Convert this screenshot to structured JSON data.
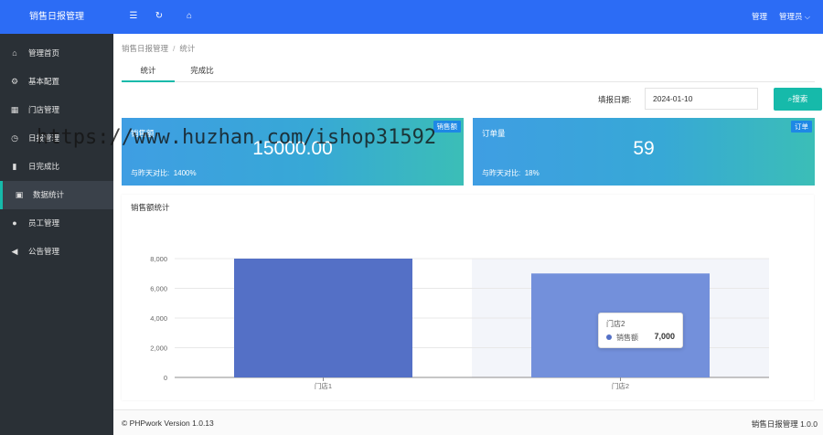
{
  "app": {
    "title": "销售日报管理"
  },
  "topbar": {
    "icons": [
      "menu-icon",
      "refresh-icon",
      "home-icon"
    ],
    "admin_link": "管理",
    "user_menu": "管理员",
    "user_caret": "⌵"
  },
  "sidebar": {
    "items": [
      {
        "label": "管理首页",
        "icon": "home-icon"
      },
      {
        "label": "基本配置",
        "icon": "settings-icon"
      },
      {
        "label": "门店管理",
        "icon": "store-icon"
      },
      {
        "label": "日报管理",
        "icon": "clock-icon"
      },
      {
        "label": "日完成比",
        "icon": "bar-chart-icon"
      },
      {
        "label": "数据统计",
        "icon": "statistics-icon",
        "active": true
      },
      {
        "label": "员工管理",
        "icon": "user-icon"
      },
      {
        "label": "公告管理",
        "icon": "speaker-icon"
      }
    ]
  },
  "breadcrumb": {
    "root": "销售日报管理",
    "separator": "/",
    "current": "统计"
  },
  "tabs": [
    {
      "label": "统计",
      "active": true
    },
    {
      "label": "完成比"
    }
  ],
  "filter": {
    "label": "填报日期:",
    "date_value": "2024-01-10",
    "search_label": "搜索"
  },
  "cards": [
    {
      "title": "销售额",
      "badge": "销售额",
      "value": "15000.00",
      "compare_label": "与昨天对比:",
      "compare_value": "1400%"
    },
    {
      "title": "订单量",
      "badge": "订单",
      "value": "59",
      "compare_label": "与昨天对比:",
      "compare_value": "18%"
    }
  ],
  "chart_title": "销售额统计",
  "chart_data": {
    "type": "bar",
    "categories": [
      "门店1",
      "门店2"
    ],
    "series": [
      {
        "name": "销售额",
        "values": [
          8000,
          7000
        ],
        "color": "#5470c6"
      }
    ],
    "ylim": [
      0,
      8000
    ],
    "yticks": [
      0,
      2000,
      4000,
      6000,
      8000
    ],
    "ytick_labels": [
      "0",
      "2,000",
      "4,000",
      "6,000",
      "8,000"
    ],
    "highlighted_category": "门店2",
    "grid": true
  },
  "tooltip": {
    "category": "门店2",
    "series": "销售额",
    "value": "7,000"
  },
  "footer": {
    "left": "© PHPwork Version 1.0.13",
    "right": "销售日报管理 1.0.0"
  },
  "watermark": "https://www.huzhan.com/ishop31592",
  "colors": {
    "header": "#2c6cf5",
    "sidebar": "#2a3036",
    "accent": "#16baaa",
    "bar": "#5470c6",
    "bar_highlight": "#7390db"
  }
}
